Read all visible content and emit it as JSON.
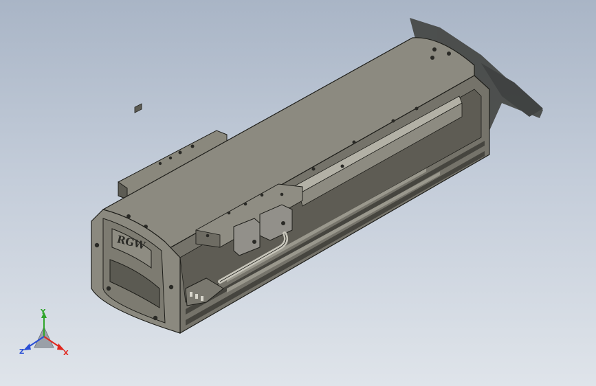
{
  "viewport": {
    "background_top": "#a9b5c6",
    "background_bottom": "#dfe4ea"
  },
  "model": {
    "brand_mark": "RGW",
    "body_color": "#7f7d72",
    "edge_color": "#1e1e1a"
  },
  "triad": {
    "x_label": "X",
    "y_label": "Y",
    "z_label": "Z",
    "x_color": "#e0271e",
    "y_color": "#2fa52a",
    "z_color": "#2a4fd6"
  }
}
